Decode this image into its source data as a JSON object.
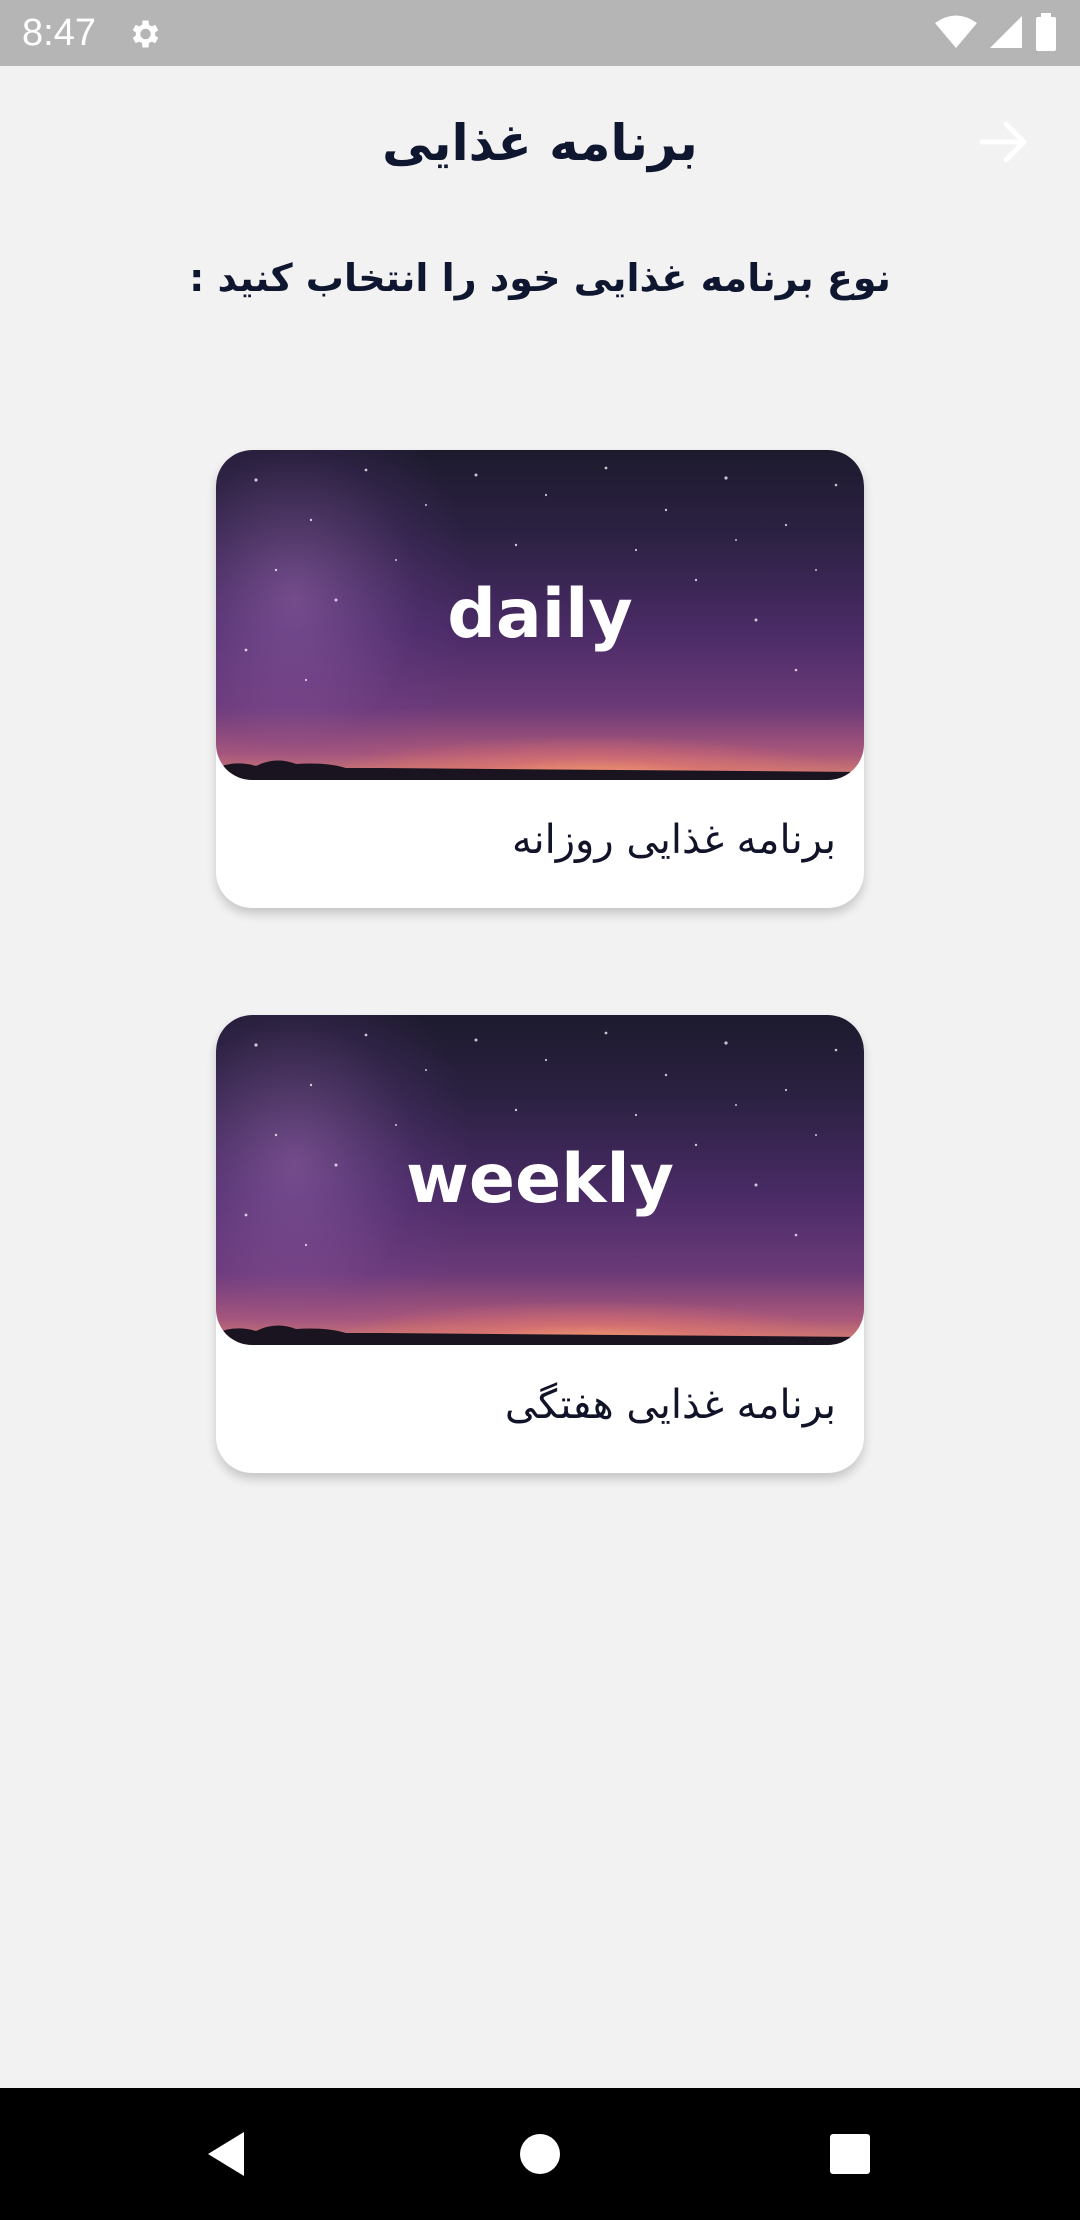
{
  "status_bar": {
    "time": "8:47",
    "icons": [
      "settings-icon",
      "wifi-icon",
      "signal-icon",
      "battery-icon"
    ]
  },
  "header": {
    "title": "برنامه غذایی",
    "back_icon": "arrow-right-icon"
  },
  "subtitle": "نوع برنامه غذایی خود را انتخاب کنید :",
  "cards": [
    {
      "image_label": "daily",
      "caption": "برنامه غذایی روزانه"
    },
    {
      "image_label": "weekly",
      "caption": "برنامه غذایی هفتگی"
    }
  ],
  "nav_bar": {
    "icons": [
      "back-triangle-icon",
      "home-circle-icon",
      "recents-square-icon"
    ]
  },
  "colors": {
    "background": "#f2f2f2",
    "status_bar": "#b5b5b5",
    "title_text": "#0f1630",
    "card_bg": "#ffffff",
    "nav_bar": "#000000"
  }
}
